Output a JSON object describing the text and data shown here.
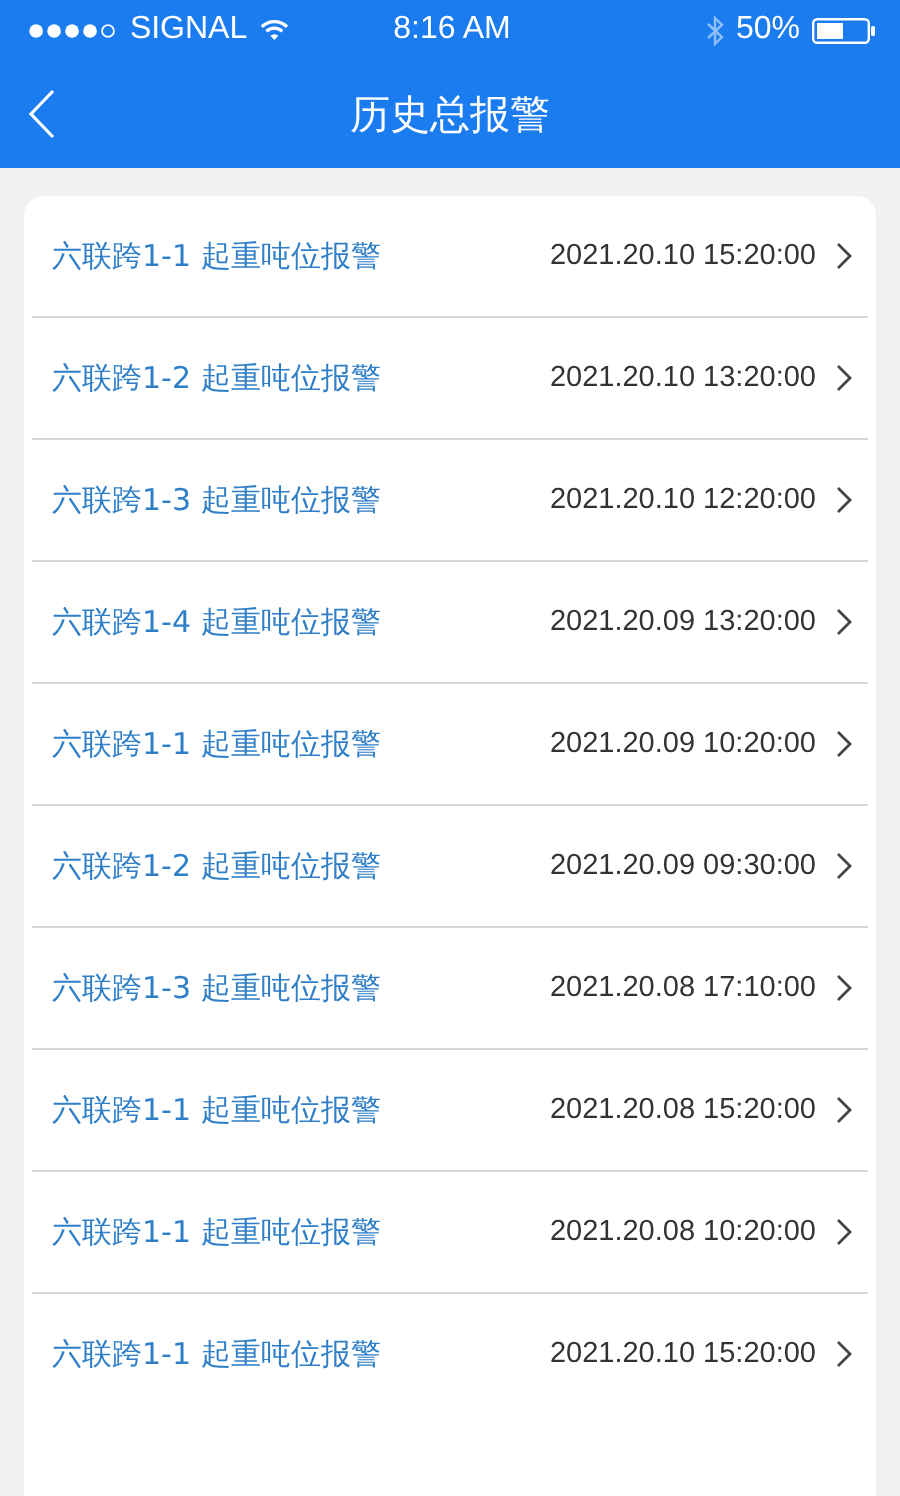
{
  "status_bar": {
    "carrier": "SIGNAL",
    "time": "8:16 AM",
    "battery": "50%"
  },
  "nav": {
    "title": "历史总报警"
  },
  "alarms": [
    {
      "name": "六联跨1-1 起重吨位报警",
      "time": "2021.20.10 15:20:00"
    },
    {
      "name": "六联跨1-2 起重吨位报警",
      "time": "2021.20.10 13:20:00"
    },
    {
      "name": "六联跨1-3 起重吨位报警",
      "time": "2021.20.10 12:20:00"
    },
    {
      "name": "六联跨1-4 起重吨位报警",
      "time": "2021.20.09 13:20:00"
    },
    {
      "name": "六联跨1-1 起重吨位报警",
      "time": "2021.20.09 10:20:00"
    },
    {
      "name": "六联跨1-2 起重吨位报警",
      "time": "2021.20.09 09:30:00"
    },
    {
      "name": "六联跨1-3 起重吨位报警",
      "time": "2021.20.08 17:10:00"
    },
    {
      "name": "六联跨1-1 起重吨位报警",
      "time": "2021.20.08 15:20:00"
    },
    {
      "name": "六联跨1-1 起重吨位报警",
      "time": "2021.20.08 10:20:00"
    },
    {
      "name": "六联跨1-1 起重吨位报警",
      "time": "2021.20.10 15:20:00"
    }
  ]
}
